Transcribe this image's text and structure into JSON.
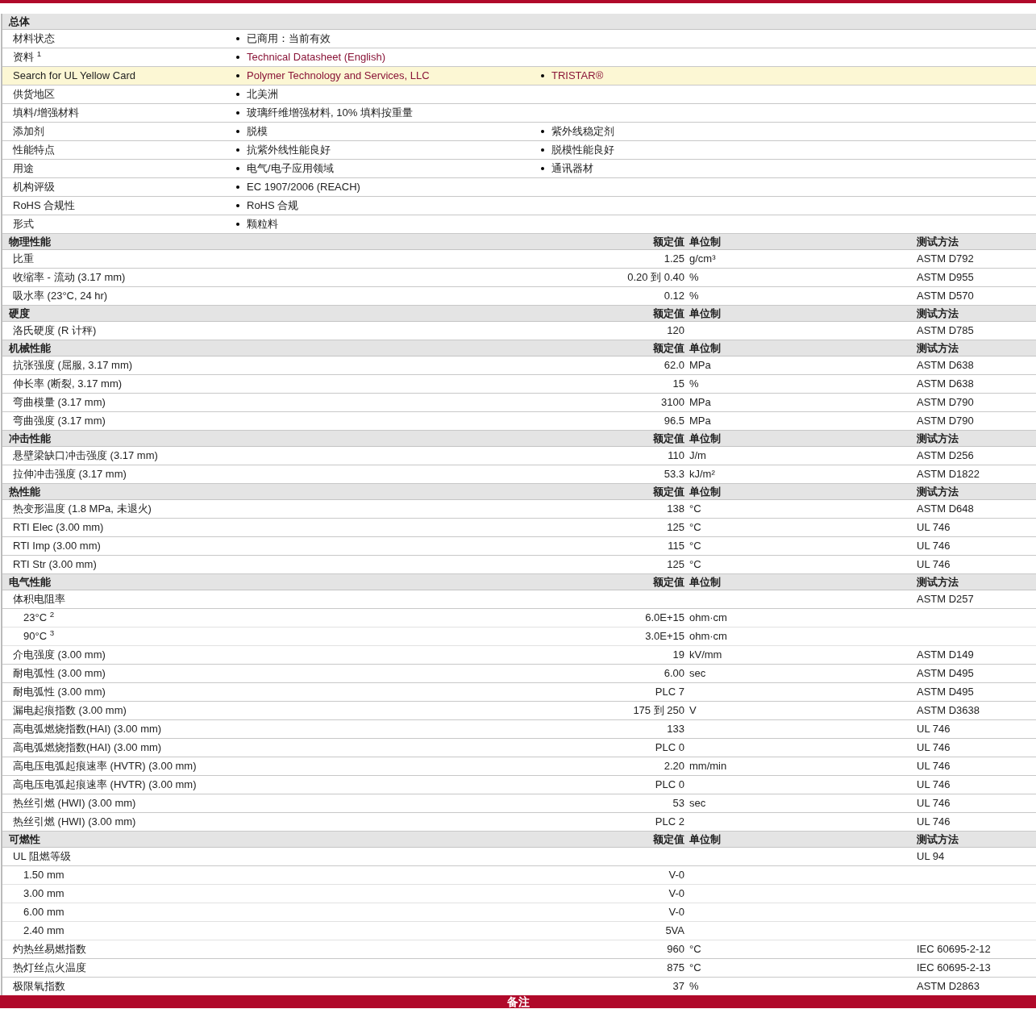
{
  "general": {
    "title": "总体",
    "rows": [
      {
        "label": "材料状态",
        "highlighted": false,
        "items": [
          {
            "text": "已商用：当前有效",
            "link": false
          }
        ]
      },
      {
        "label": "资料 $^{1}$",
        "highlighted": false,
        "items": [
          {
            "text": "Technical Datasheet (English)",
            "link": true
          }
        ]
      },
      {
        "label": "Search for UL Yellow Card",
        "highlighted": true,
        "items": [
          {
            "text": "Polymer Technology and Services, LLC",
            "link": true
          },
          {
            "text": "TRISTAR®",
            "link": true
          }
        ]
      },
      {
        "label": "供货地区",
        "highlighted": false,
        "items": [
          {
            "text": "北美洲",
            "link": false
          }
        ]
      },
      {
        "label": "填料/增强材料",
        "highlighted": false,
        "items": [
          {
            "text": "玻璃纤维增强材料, 10% 填料按重量",
            "link": false
          }
        ]
      },
      {
        "label": "添加剂",
        "highlighted": false,
        "items": [
          {
            "text": "脱模",
            "link": false
          },
          {
            "text": "紫外线稳定剂",
            "link": false
          }
        ]
      },
      {
        "label": "性能特点",
        "highlighted": false,
        "items": [
          {
            "text": "抗紫外线性能良好",
            "link": false
          },
          {
            "text": "脱模性能良好",
            "link": false
          }
        ]
      },
      {
        "label": "用途",
        "highlighted": false,
        "items": [
          {
            "text": "电气/电子应用领域",
            "link": false
          },
          {
            "text": "通讯器材",
            "link": false
          }
        ]
      },
      {
        "label": "机构评级",
        "highlighted": false,
        "items": [
          {
            "text": "EC 1907/2006 (REACH)",
            "link": false
          }
        ]
      },
      {
        "label": "RoHS 合规性",
        "highlighted": false,
        "items": [
          {
            "text": "RoHS 合规",
            "link": false
          }
        ]
      },
      {
        "label": "形式",
        "highlighted": false,
        "items": [
          {
            "text": "颗粒料",
            "link": false
          }
        ]
      }
    ]
  },
  "sections": [
    {
      "title": "物理性能",
      "value_heading": "额定值",
      "unit_heading": "单位制",
      "method_heading": "测试方法",
      "rows": [
        {
          "label": "比重",
          "value": "1.25",
          "unit": "g/cm³",
          "method": "ASTM D792"
        },
        {
          "label": "收缩率 - 流动 (3.17 mm)",
          "value": "0.20 到  0.40",
          "unit": "%",
          "method": "ASTM D955"
        },
        {
          "label": "吸水率 (23°C, 24 hr)",
          "value": "0.12",
          "unit": "%",
          "method": "ASTM D570"
        }
      ]
    },
    {
      "title": "硬度",
      "value_heading": "额定值",
      "unit_heading": "单位制",
      "method_heading": "测试方法",
      "rows": [
        {
          "label": "洛氏硬度 (R 计秤)",
          "value": "120",
          "method": "ASTM D785"
        }
      ]
    },
    {
      "title": "机械性能",
      "value_heading": "额定值",
      "unit_heading": "单位制",
      "method_heading": "测试方法",
      "rows": [
        {
          "label": "抗张强度 (屈服, 3.17 mm)",
          "value": "62.0",
          "unit": "MPa",
          "method": "ASTM D638"
        },
        {
          "label": "伸长率 (断裂, 3.17 mm)",
          "value": "15",
          "unit": "%",
          "method": "ASTM D638"
        },
        {
          "label": "弯曲模量 (3.17 mm)",
          "value": "3100",
          "unit": "MPa",
          "method": "ASTM D790"
        },
        {
          "label": "弯曲强度 (3.17 mm)",
          "value": "96.5",
          "unit": "MPa",
          "method": "ASTM D790"
        }
      ]
    },
    {
      "title": "冲击性能",
      "value_heading": "额定值",
      "unit_heading": "单位制",
      "method_heading": "测试方法",
      "rows": [
        {
          "label": "悬壁梁缺口冲击强度 (3.17 mm)",
          "value": "110",
          "unit": "J/m",
          "method": "ASTM D256"
        },
        {
          "label": "拉伸冲击强度 (3.17 mm)",
          "value": "53.3",
          "unit": "kJ/m²",
          "method": "ASTM D1822"
        }
      ]
    },
    {
      "title": "热性能",
      "value_heading": "额定值",
      "unit_heading": "单位制",
      "method_heading": "测试方法",
      "rows": [
        {
          "label": "热变形温度 (1.8 MPa, 未退火)",
          "value": "138",
          "unit": "°C",
          "method": "ASTM D648"
        },
        {
          "label": "RTI Elec (3.00 mm)",
          "value": "125",
          "unit": "°C",
          "method": "UL 746"
        },
        {
          "label": "RTI Imp (3.00 mm)",
          "value": "115",
          "unit": "°C",
          "method": "UL 746"
        },
        {
          "label": "RTI Str (3.00 mm)",
          "value": "125",
          "unit": "°C",
          "method": "UL 746"
        }
      ]
    },
    {
      "title": "电气性能",
      "value_heading": "额定值",
      "unit_heading": "单位制",
      "method_heading": "测试方法",
      "rows": [
        {
          "label": "体积电阻率",
          "method": "ASTM D257",
          "children": [
            {
              "label": "23°C $^{2}$",
              "value": "6.0E+15",
              "unit": "ohm·cm"
            },
            {
              "label": "90°C $^{3}$",
              "value": "3.0E+15",
              "unit": "ohm·cm"
            }
          ]
        },
        {
          "label": "介电强度 (3.00 mm)",
          "value": "19",
          "unit": "kV/mm",
          "method": "ASTM D149"
        },
        {
          "label": "耐电弧性 (3.00 mm)",
          "value": "6.00",
          "unit": "sec",
          "method": "ASTM D495"
        },
        {
          "label": "耐电弧性 (3.00 mm)",
          "value": "PLC 7",
          "method": "ASTM D495"
        },
        {
          "label": "漏电起痕指数 (3.00 mm)",
          "value": "175 到  250",
          "unit": "V",
          "method": "ASTM D3638"
        },
        {
          "label": "高电弧燃烧指数(HAI) (3.00 mm)",
          "value": "133",
          "method": "UL 746"
        },
        {
          "label": "高电弧燃烧指数(HAI) (3.00 mm)",
          "value": "PLC 0",
          "method": "UL 746"
        },
        {
          "label": "高电压电弧起痕速率 (HVTR) (3.00 mm)",
          "value": "2.20",
          "unit": "mm/min",
          "method": "UL 746"
        },
        {
          "label": "高电压电弧起痕速率 (HVTR) (3.00 mm)",
          "value": "PLC 0",
          "method": "UL 746"
        },
        {
          "label": "热丝引燃 (HWI) (3.00 mm)",
          "value": "53",
          "unit": "sec",
          "method": "UL 746"
        },
        {
          "label": "热丝引燃 (HWI) (3.00 mm)",
          "value": "PLC 2",
          "method": "UL 746"
        }
      ]
    },
    {
      "title": "可燃性",
      "value_heading": "额定值",
      "unit_heading": "单位制",
      "method_heading": "测试方法",
      "rows": [
        {
          "label": "UL 阻燃等级",
          "method": "UL 94",
          "children": [
            {
              "label": "1.50 mm",
              "value": "V-0"
            },
            {
              "label": "3.00 mm",
              "value": "V-0"
            },
            {
              "label": "6.00 mm",
              "value": "V-0"
            },
            {
              "label": "2.40 mm",
              "value": "5VA"
            }
          ]
        },
        {
          "label": "灼热丝易燃指数",
          "value": "960",
          "unit": "°C",
          "method": "IEC 60695-2-12"
        },
        {
          "label": "热灯丝点火温度",
          "value": "875",
          "unit": "°C",
          "method": "IEC 60695-2-13"
        },
        {
          "label": "极限氧指数",
          "value": "37",
          "unit": "%",
          "method": "ASTM D2863"
        }
      ]
    }
  ],
  "footer_bar": {
    "title": "备注"
  }
}
